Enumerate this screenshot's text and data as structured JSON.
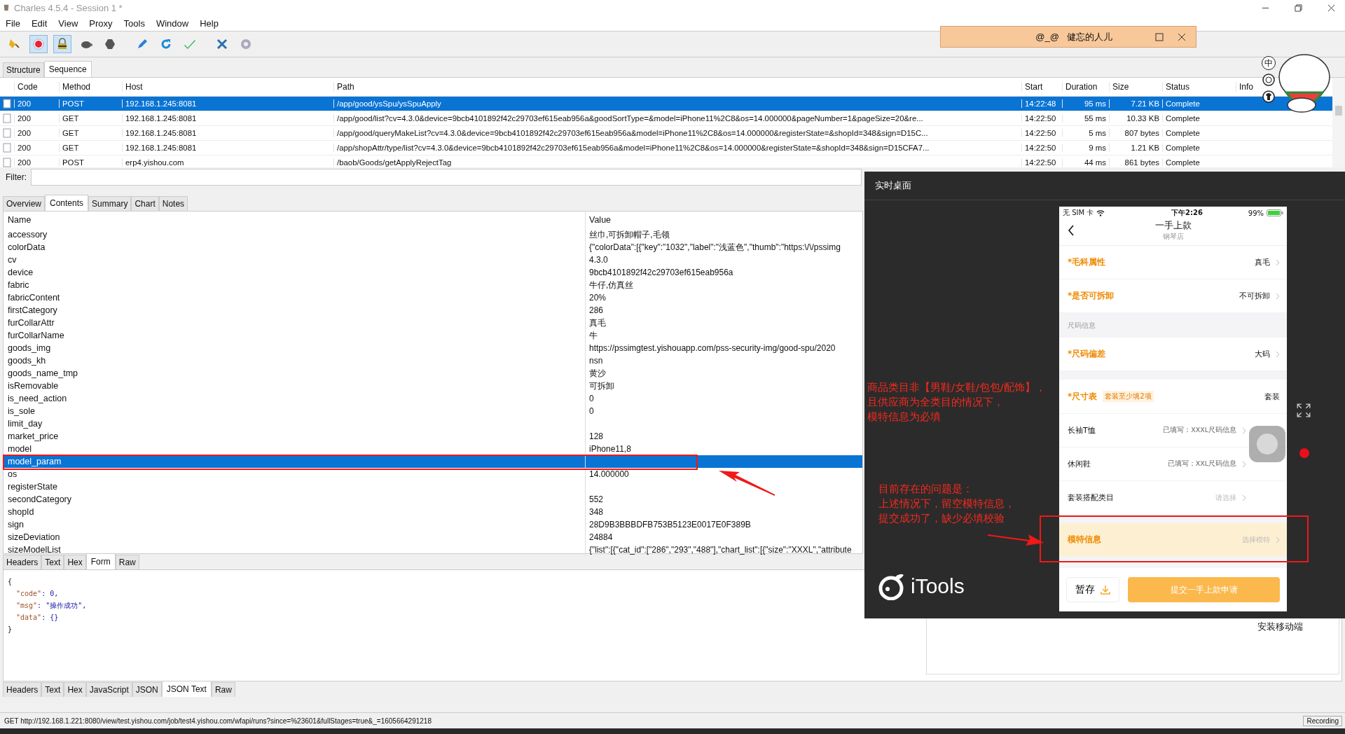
{
  "window": {
    "title": "Charles 4.5.4 - Session 1 *"
  },
  "menu": [
    "File",
    "Edit",
    "View",
    "Proxy",
    "Tools",
    "Window",
    "Help"
  ],
  "toolbar": [
    {
      "kind": "broom",
      "pressed": false
    },
    {
      "kind": "record",
      "pressed": true
    },
    {
      "kind": "throttle",
      "pressed": true
    },
    {
      "kind": "turtle",
      "pressed": false
    },
    {
      "kind": "stop",
      "pressed": false
    },
    {
      "kind": "pen",
      "pressed": false
    },
    {
      "kind": "refresh",
      "pressed": false
    },
    {
      "kind": "validate",
      "pressed": false
    },
    {
      "kind": "tools",
      "pressed": false
    },
    {
      "kind": "gear",
      "pressed": false
    }
  ],
  "view_tabs": [
    {
      "label": "Structure",
      "selected": false
    },
    {
      "label": "Sequence",
      "selected": true
    }
  ],
  "sequence": {
    "columns": [
      "Code",
      "Method",
      "Host",
      "Path",
      "Start",
      "Duration",
      "Size",
      "Status",
      "Info"
    ],
    "rows": [
      {
        "selected": true,
        "cells": [
          "200",
          "POST",
          "192.168.1.245:8081",
          "/app/good/ysSpu/ysSpuApply",
          "14:22:48",
          "95 ms",
          "7.21 KB",
          "Complete"
        ]
      },
      {
        "selected": false,
        "cells": [
          "200",
          "GET",
          "192.168.1.245:8081",
          "/app/good/list?cv=4.3.0&device=9bcb4101892f42c29703ef615eab956a&goodSortType=&model=iPhone11%2C8&os=14.000000&pageNumber=1&pageSize=20&re...",
          "14:22:50",
          "55 ms",
          "10.33 KB",
          "Complete"
        ]
      },
      {
        "selected": false,
        "cells": [
          "200",
          "GET",
          "192.168.1.245:8081",
          "/app/good/queryMakeList?cv=4.3.0&device=9bcb4101892f42c29703ef615eab956a&model=iPhone11%2C8&os=14.000000&registerState=&shopId=348&sign=D15C...",
          "14:22:50",
          "5 ms",
          "807 bytes",
          "Complete"
        ]
      },
      {
        "selected": false,
        "cells": [
          "200",
          "GET",
          "192.168.1.245:8081",
          "/app/shopAttr/type/list?cv=4.3.0&device=9bcb4101892f42c29703ef615eab956a&model=iPhone11%2C8&os=14.000000&registerState=&shopId=348&sign=D15CFA7...",
          "14:22:50",
          "9 ms",
          "1.21 KB",
          "Complete"
        ]
      },
      {
        "selected": false,
        "cells": [
          "200",
          "POST",
          "erp4.yishou.com",
          "/baob/Goods/getApplyRejectTag",
          "14:22:50",
          "44 ms",
          "861 bytes",
          "Complete"
        ]
      }
    ]
  },
  "filter": {
    "label": "Filter:"
  },
  "detail_tabs": [
    {
      "label": "Overview",
      "selected": false
    },
    {
      "label": "Contents",
      "selected": true
    },
    {
      "label": "Summary",
      "selected": false
    },
    {
      "label": "Chart",
      "selected": false
    },
    {
      "label": "Notes",
      "selected": false
    }
  ],
  "form": {
    "columns": [
      "Name",
      "Value"
    ],
    "rows": [
      {
        "name": "accessory",
        "value": "丝巾,可拆卸帽子,毛领",
        "selected": false
      },
      {
        "name": "colorData",
        "value": "{\"colorData\":[{\"key\":\"1032\",\"label\":\"浅蓝色\",\"thumb\":\"https:\\/\\/pssimg",
        "selected": false
      },
      {
        "name": "cv",
        "value": "4.3.0",
        "selected": false
      },
      {
        "name": "device",
        "value": "9bcb4101892f42c29703ef615eab956a",
        "selected": false
      },
      {
        "name": "fabric",
        "value": "牛仔,仿真丝",
        "selected": false
      },
      {
        "name": "fabricContent",
        "value": "20%",
        "selected": false
      },
      {
        "name": "firstCategory",
        "value": "286",
        "selected": false
      },
      {
        "name": "furCollarAttr",
        "value": "真毛",
        "selected": false
      },
      {
        "name": "furCollarName",
        "value": "牛",
        "selected": false
      },
      {
        "name": "goods_img",
        "value": "https://pssimgtest.yishouapp.com/pss-security-img/good-spu/2020",
        "selected": false
      },
      {
        "name": "goods_kh",
        "value": "nsn",
        "selected": false
      },
      {
        "name": "goods_name_tmp",
        "value": "黄沙",
        "selected": false
      },
      {
        "name": "isRemovable",
        "value": "可拆卸",
        "selected": false
      },
      {
        "name": "is_need_action",
        "value": "0",
        "selected": false
      },
      {
        "name": "is_sole",
        "value": "0",
        "selected": false
      },
      {
        "name": "limit_day",
        "selected": false
      },
      {
        "name": "market_price",
        "value": "128",
        "selected": false
      },
      {
        "name": "model",
        "value": "iPhone11,8",
        "selected": false
      },
      {
        "name": "model_param",
        "selected": true
      },
      {
        "name": "os",
        "value": "14.000000",
        "selected": false
      },
      {
        "name": "registerState",
        "selected": false
      },
      {
        "name": "secondCategory",
        "value": "552",
        "selected": false
      },
      {
        "name": "shopId",
        "value": "348",
        "selected": false
      },
      {
        "name": "sign",
        "value": "28D9B3BBBDFB753B5123E0017E0F389B",
        "selected": false
      },
      {
        "name": "sizeDeviation",
        "value": "24884",
        "selected": false
      },
      {
        "name": "sizeModelList",
        "value": "{\"list\":[{\"cat_id\":[\"286\",\"293\",\"488\"],\"chart_list\":[{\"size\":\"XXXL\",\"attribute",
        "selected": false
      }
    ]
  },
  "request_tabs": [
    {
      "label": "Headers",
      "selected": false
    },
    {
      "label": "Text",
      "selected": false
    },
    {
      "label": "Hex",
      "selected": false
    },
    {
      "label": "Form",
      "selected": true
    },
    {
      "label": "Raw",
      "selected": false
    }
  ],
  "response": {
    "lines": [
      {
        "kind": "brace",
        "text": "{"
      },
      {
        "kind": "pair",
        "key": "\"code\"",
        "value": ": 0,"
      },
      {
        "kind": "pair",
        "key": "\"msg\"",
        "value": ": \"操作成功\","
      },
      {
        "kind": "pair",
        "key": "\"data\"",
        "value": ": {}"
      },
      {
        "kind": "brace",
        "text": "}"
      }
    ]
  },
  "response_tabs": [
    {
      "label": "Headers",
      "selected": false
    },
    {
      "label": "Text",
      "selected": false
    },
    {
      "label": "Hex",
      "selected": false
    },
    {
      "label": "JavaScript",
      "selected": false
    },
    {
      "label": "JSON",
      "selected": false
    },
    {
      "label": "JSON Text",
      "selected": true
    },
    {
      "label": "Raw",
      "selected": false
    }
  ],
  "status_bar": {
    "text": "GET http://192.168.1.221:8080/view/test.yishou.com/job/test4.yishou.com/wfapi/runs?since=%23601&fullStages=true&_=1605664291218",
    "badge": "Recording"
  },
  "chat_popup": {
    "title": "@_@   健忘的人儿"
  },
  "sticker_bubbles": [
    {
      "kind": "text",
      "text": "中"
    },
    {
      "kind": "emoji"
    },
    {
      "kind": "shirt"
    }
  ],
  "itools": {
    "title": "实时桌面",
    "logo": "iTools",
    "behind_text": "安装移动端",
    "phone": {
      "carrier": "无 SIM 卡",
      "time": "下午2:26",
      "battery": "99%",
      "title": "一手上款",
      "subtitle": "钢琴店",
      "rows": [
        {
          "kind": "field",
          "label": "*毛科属性",
          "value": "真毛",
          "selected": false
        },
        {
          "kind": "field",
          "label": "*是否可拆卸",
          "value": "不可拆卸",
          "selected": false
        },
        {
          "kind": "section",
          "label": "尺码信息"
        },
        {
          "kind": "field",
          "label": "*尺码偏差",
          "value": "大码",
          "selected": false
        },
        {
          "kind": "gap"
        },
        {
          "kind": "table",
          "label": "*尺寸表",
          "tag": "套装至少填2项",
          "value": "套装",
          "selected": false
        },
        {
          "kind": "sub",
          "label": "长袖T恤",
          "value": "已填写：XXXL尺码信息",
          "selected": false
        },
        {
          "kind": "sub",
          "label": "休闲鞋",
          "value": "已填写：XXL尺码信息",
          "selected": false
        },
        {
          "kind": "sub",
          "label": "套装搭配类目",
          "placeholder": "请选择",
          "selected": false
        },
        {
          "kind": "gap"
        },
        {
          "kind": "field",
          "label": "模特信息",
          "placeholder": "选择模特",
          "selected": true
        }
      ],
      "save_button": "暂存",
      "submit_button": "提交一手上款申请"
    }
  },
  "annotations": [
    {
      "lines": [
        "商品类目非【男鞋/女鞋/包包/配饰】，",
        "且供应商为全类目的情况下，",
        "模特信息为必填"
      ]
    },
    {
      "lines": [
        "目前存在的问题是：",
        "上述情况下，留空模特信息，",
        "提交成功了，缺少必填校验"
      ]
    }
  ]
}
